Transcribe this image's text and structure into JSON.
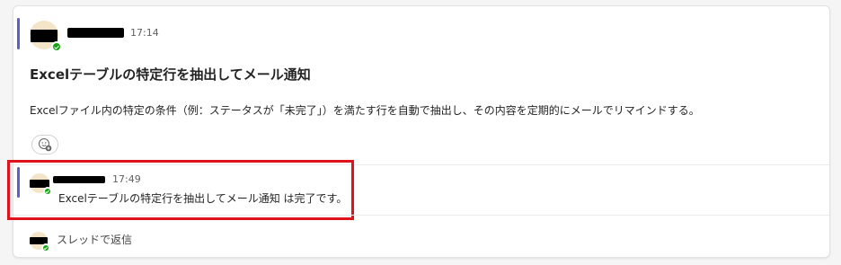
{
  "post": {
    "time": "17:14",
    "title": "Excelテーブルの特定行を抽出してメール通知",
    "body": "Excelファイル内の特定の条件（例：ステータスが「未完了」）を満たす行を自動で抽出し、その内容を定期的にメールでリマインドする。",
    "reaction_icon": "add-reaction-icon"
  },
  "reply": {
    "time": "17:49",
    "text": "Excelテーブルの特定行を抽出してメール通知 は完了です。"
  },
  "footer": {
    "reply_label": "スレッドで返信"
  },
  "colors": {
    "accent": "#5b5fc7",
    "presence": "#13a10e",
    "highlight": "#e0131d"
  }
}
